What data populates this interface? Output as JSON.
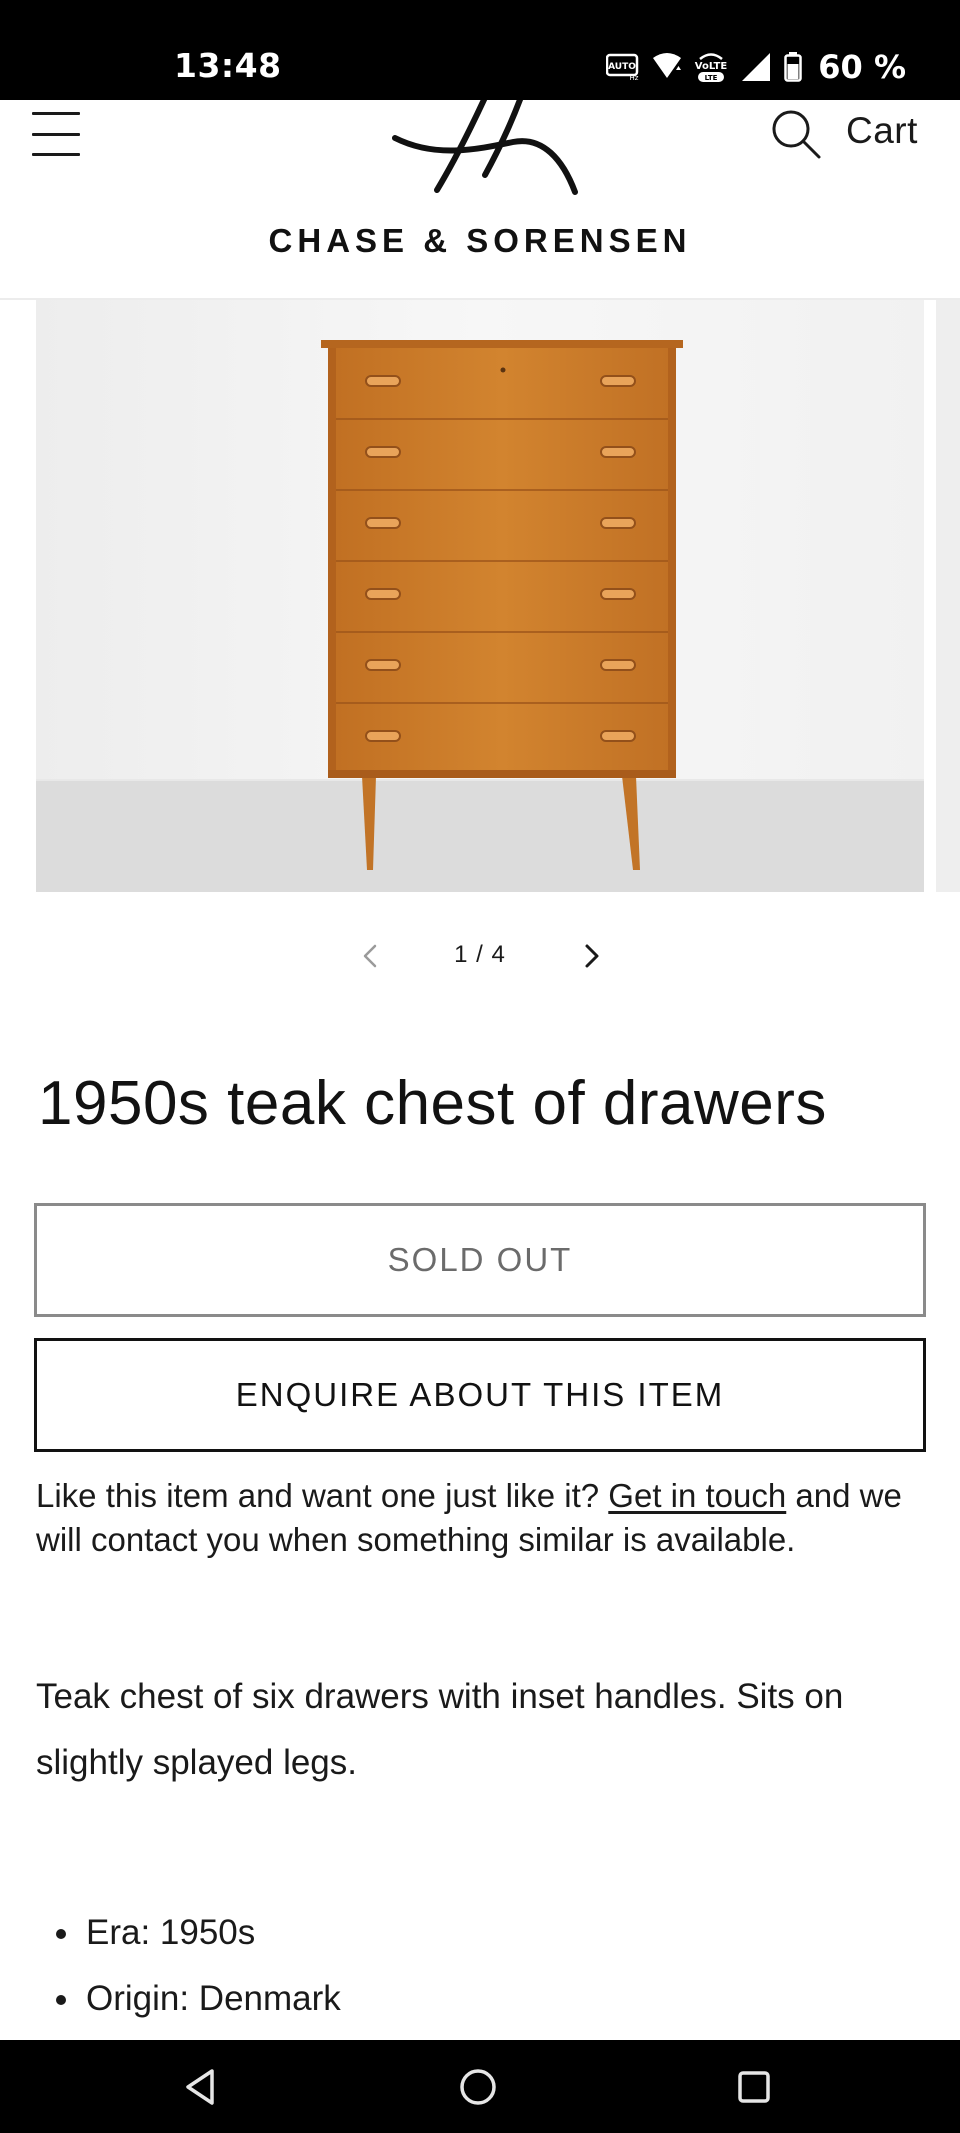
{
  "status_bar": {
    "time": "13:48",
    "battery": "60 %",
    "icons": [
      "auto-hz-icon",
      "wifi-icon",
      "volte-icon",
      "signal-icon",
      "battery-icon"
    ]
  },
  "header": {
    "brand": "CHASE & SORENSEN",
    "cart_label": "Cart",
    "icons": [
      "menu-icon",
      "logo-mark",
      "search-icon"
    ]
  },
  "gallery": {
    "counter": "1 / 4",
    "current": 1,
    "total": 4,
    "icons": [
      "chevron-left-icon",
      "chevron-right-icon"
    ]
  },
  "product": {
    "title": "1950s teak chest of drawers",
    "sold_out_label": "SOLD OUT",
    "enquire_label": "ENQUIRE ABOUT THIS ITEM",
    "note_before": "Like this item and want one just like it? ",
    "note_link": "Get in touch",
    "note_after": " and we will contact you when something similar is available.",
    "description": "Teak chest of six drawers with inset handles. Sits on slightly splayed legs.",
    "specs": [
      "Era: 1950s",
      "Origin: Denmark"
    ]
  },
  "colors": {
    "wood": "#c9782a",
    "wood_dark": "#a9601c",
    "text": "#1a1a1a",
    "sold_out_border": "#8a8a8a"
  },
  "nav_bar": {
    "icons": [
      "back-icon",
      "home-icon",
      "recents-icon"
    ]
  }
}
